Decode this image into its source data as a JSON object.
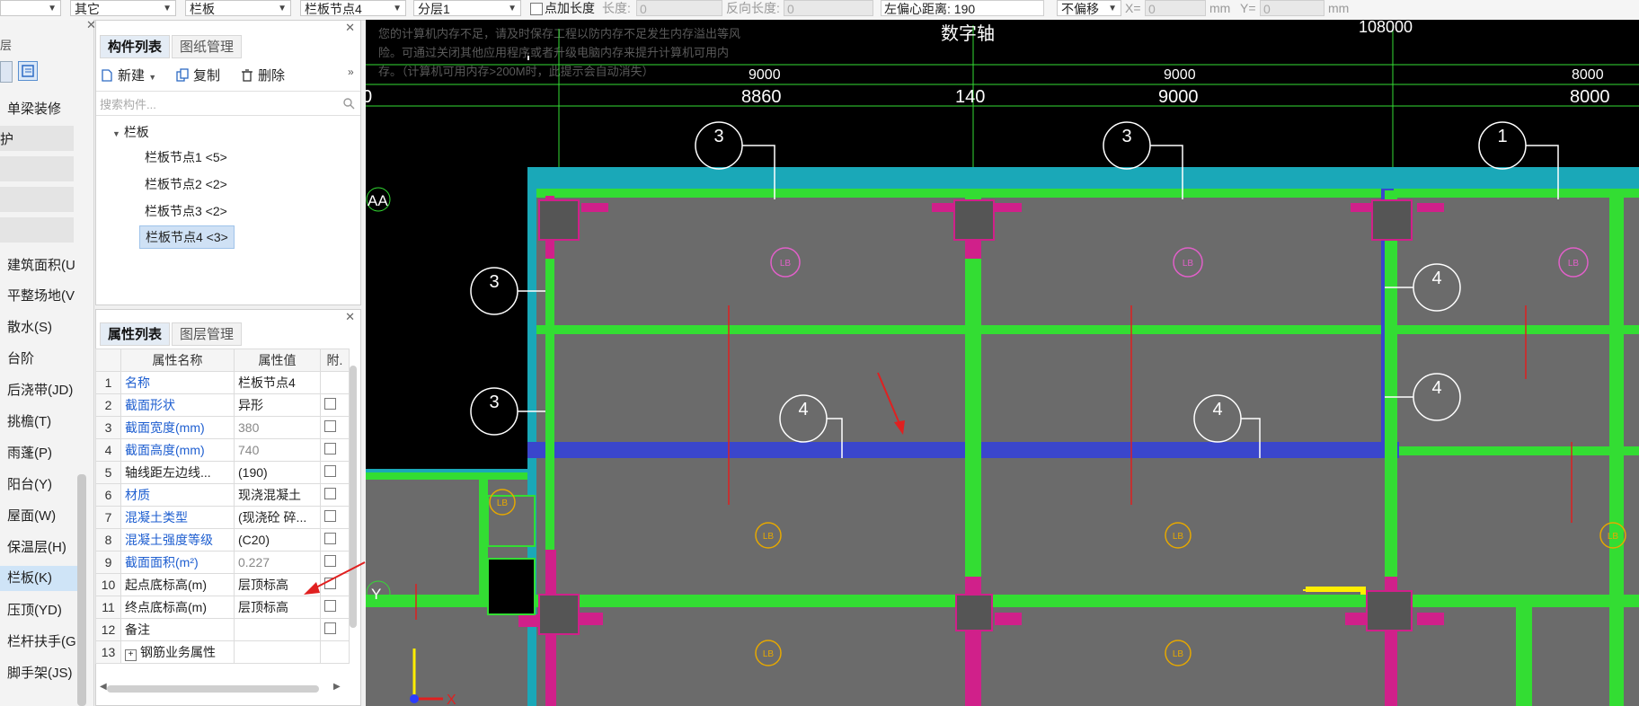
{
  "toolbar": {
    "combo1": "其它",
    "combo2": "栏板",
    "combo3": "栏板节点4",
    "combo4": "分层1",
    "point_length_label": "点加长度",
    "length_label": "长度:",
    "length_value": "0",
    "reverse_length_label": "反向长度:",
    "reverse_length_value": "0",
    "left_offset_label": "左偏心距离:",
    "left_offset_value": "190",
    "offset_mode": "不偏移",
    "x_label": "X=",
    "x_value": "0",
    "mm1": "mm",
    "y_label": "Y=",
    "y_value": "0",
    "mm2": "mm"
  },
  "leftnav": {
    "top_label": "层",
    "items": [
      {
        "label": "单梁装修"
      },
      {
        "label": "护"
      },
      {
        "label": "建筑面积(U"
      },
      {
        "label": "平整场地(V"
      },
      {
        "label": "散水(S)"
      },
      {
        "label": "台阶"
      },
      {
        "label": "后浇带(JD)"
      },
      {
        "label": "挑檐(T)"
      },
      {
        "label": "雨蓬(P)"
      },
      {
        "label": "阳台(Y)"
      },
      {
        "label": "屋面(W)"
      },
      {
        "label": "保温层(H)"
      },
      {
        "label": "栏板(K)"
      },
      {
        "label": "压顶(YD)"
      },
      {
        "label": "栏杆扶手(G"
      },
      {
        "label": "脚手架(JS)"
      }
    ]
  },
  "component_panel": {
    "tab_active": "构件列表",
    "tab_other": "图纸管理",
    "new_label": "新建",
    "copy_label": "复制",
    "delete_label": "删除",
    "search_placeholder": "搜索构件...",
    "tree_root": "栏板",
    "tree_items": [
      {
        "label": "栏板节点1 <5>"
      },
      {
        "label": "栏板节点2 <2>"
      },
      {
        "label": "栏板节点3 <2>"
      },
      {
        "label": "栏板节点4 <3>"
      }
    ]
  },
  "property_panel": {
    "tab_active": "属性列表",
    "tab_other": "图层管理",
    "headers": [
      "属性名称",
      "属性值",
      "附."
    ],
    "rows": [
      {
        "num": "1",
        "name": "名称",
        "value": "栏板节点4"
      },
      {
        "num": "2",
        "name": "截面形状",
        "value": "异形"
      },
      {
        "num": "3",
        "name": "截面宽度(mm)",
        "value": "380"
      },
      {
        "num": "4",
        "name": "截面高度(mm)",
        "value": "740"
      },
      {
        "num": "5",
        "name": "轴线距左边线...",
        "value": "(190)"
      },
      {
        "num": "6",
        "name": "材质",
        "value": "现浇混凝土"
      },
      {
        "num": "7",
        "name": "混凝土类型",
        "value": "(现浇砼 碎..."
      },
      {
        "num": "8",
        "name": "混凝土强度等级",
        "value": "(C20)"
      },
      {
        "num": "9",
        "name": "截面面积(m²)",
        "value": "0.227"
      },
      {
        "num": "10",
        "name": "起点底标高(m)",
        "value": "层顶标高"
      },
      {
        "num": "11",
        "name": "终点底标高(m)",
        "value": "层顶标高"
      },
      {
        "num": "12",
        "name": "备注",
        "value": ""
      },
      {
        "num": "13",
        "name": "钢筋业务属性",
        "value": ""
      }
    ]
  },
  "canvas": {
    "warning_lines": [
      "您的计算机内存不足，请及时保存工程以防内存不足发生内存溢出等风",
      "险。可通过关闭其他应用程序或者升级电脑内存来提升计算机可用内",
      "存。（计算机可用内存>200M时，此提示会自动消失）"
    ],
    "axis_title": "数字轴",
    "top_label_right": "108000",
    "dims_small": [
      "9000",
      "9000",
      "8000"
    ],
    "dims_large": [
      "0",
      "8860",
      "140",
      "9000",
      "8000"
    ],
    "axis_left_AA": "AA",
    "axis_left_Y": "Y",
    "bubble_3": "3",
    "bubble_1": "1",
    "bubble_4": "4",
    "tag_text": "LB",
    "x_axis_label": "X",
    "colors": {
      "green": "#33dd33",
      "magenta": "#d0208a",
      "slab": "#6b6b6b",
      "blue_beam": "#3a46cc",
      "cyan": "#1aa8b8",
      "orange": "#e6a800"
    }
  }
}
